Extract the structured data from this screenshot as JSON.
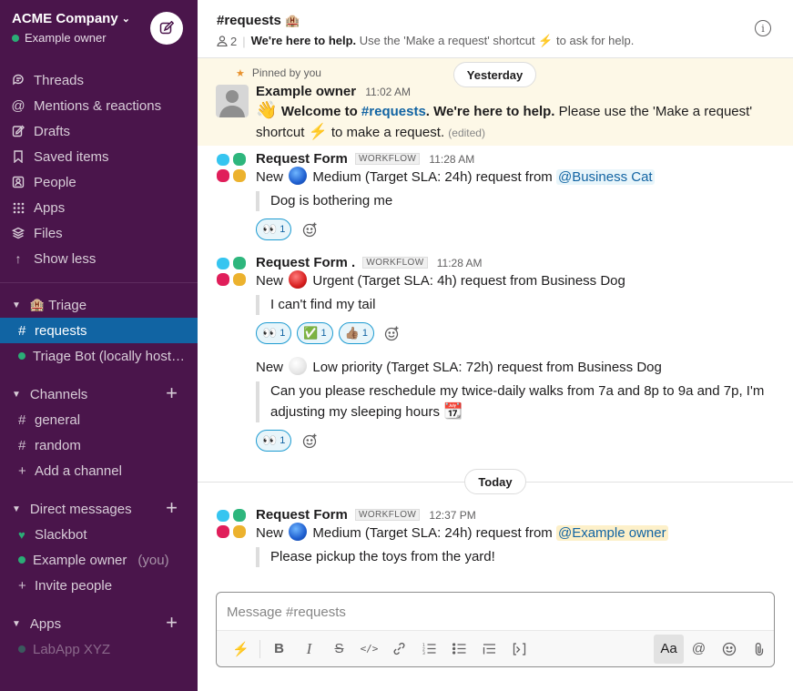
{
  "workspace": {
    "name": "ACME Company",
    "user": "Example owner"
  },
  "nav": [
    {
      "label": "Threads",
      "icon": "threads-icon"
    },
    {
      "label": "Mentions & reactions",
      "icon": "at-icon"
    },
    {
      "label": "Drafts",
      "icon": "drafts-icon"
    },
    {
      "label": "Saved items",
      "icon": "bookmark-icon"
    },
    {
      "label": "People",
      "icon": "people-icon"
    },
    {
      "label": "Apps",
      "icon": "apps-icon"
    },
    {
      "label": "Files",
      "icon": "files-icon"
    },
    {
      "label": "Show less",
      "icon": "arrow-up-icon"
    }
  ],
  "triage": {
    "title": "Triage",
    "items": [
      {
        "label": "requests",
        "prefix": "#"
      },
      {
        "label": "Triage Bot (locally host…"
      }
    ]
  },
  "channels": {
    "title": "Channels",
    "items": [
      "general",
      "random"
    ],
    "add": "Add a channel"
  },
  "dms": {
    "title": "Direct messages",
    "slackbot": "Slackbot",
    "owner": "Example owner",
    "you": "(you)",
    "invite": "Invite people"
  },
  "apps": {
    "title": "Apps",
    "partial": "LabApp XYZ"
  },
  "header": {
    "title": "#requests",
    "members": "2",
    "desc_bold": "We're here to help.",
    "desc": "Use the 'Make a request' shortcut ⚡ to ask for help."
  },
  "pinned": {
    "label": "Pinned by you",
    "day": "Yesterday",
    "author": "Example owner",
    "time": "11:02 AM",
    "text_1": "Welcome to",
    "link": "#requests",
    "text_2": ". We're here to help.",
    "text_3": "Please use the 'Make a request'",
    "text_4": "shortcut",
    "text_5": "to make a request.",
    "edited": "(edited)"
  },
  "messages": {
    "m1": {
      "author": "Request Form",
      "badge": "WORKFLOW",
      "time": "11:28 AM",
      "text": "New",
      "priority": "Medium (Target SLA: 24h) request from",
      "mention": "@Business Cat",
      "quote": "Dog is bothering me",
      "reactions": [
        {
          "emoji": "👀",
          "count": "1"
        }
      ]
    },
    "m2": {
      "author": "Request Form .",
      "badge": "WORKFLOW",
      "time": "11:28 AM",
      "text": "New",
      "priority": "Urgent (Target SLA: 4h) request from Business Dog",
      "quote": "I can't find my tail",
      "reactions": [
        {
          "emoji": "👀",
          "count": "1"
        },
        {
          "emoji": "✅",
          "count": "1"
        },
        {
          "emoji": "👍🏽",
          "count": "1"
        }
      ]
    },
    "m3": {
      "text": "New",
      "priority": "Low priority (Target SLA: 72h) request from Business Dog",
      "quote_1": "Can you please reschedule my twice-daily walks from 7a and 8p to 9a and 7p, I'm",
      "quote_2": "adjusting my sleeping hours",
      "reactions": [
        {
          "emoji": "👀",
          "count": "1"
        }
      ]
    },
    "today": "Today",
    "m4": {
      "author": "Request Form",
      "badge": "WORKFLOW",
      "time": "12:37 PM",
      "text": "New",
      "priority": "Medium (Target SLA: 24h) request from",
      "mention": "@Example owner",
      "quote": "Please pickup the toys from the yard!"
    }
  },
  "composer": {
    "placeholder": "Message #requests",
    "format_label": "Aa"
  },
  "colors": {
    "sidebar": "#4a154b",
    "active": "#1164a3",
    "link": "#1264a3",
    "pinned_bg": "#fdf8e7"
  }
}
